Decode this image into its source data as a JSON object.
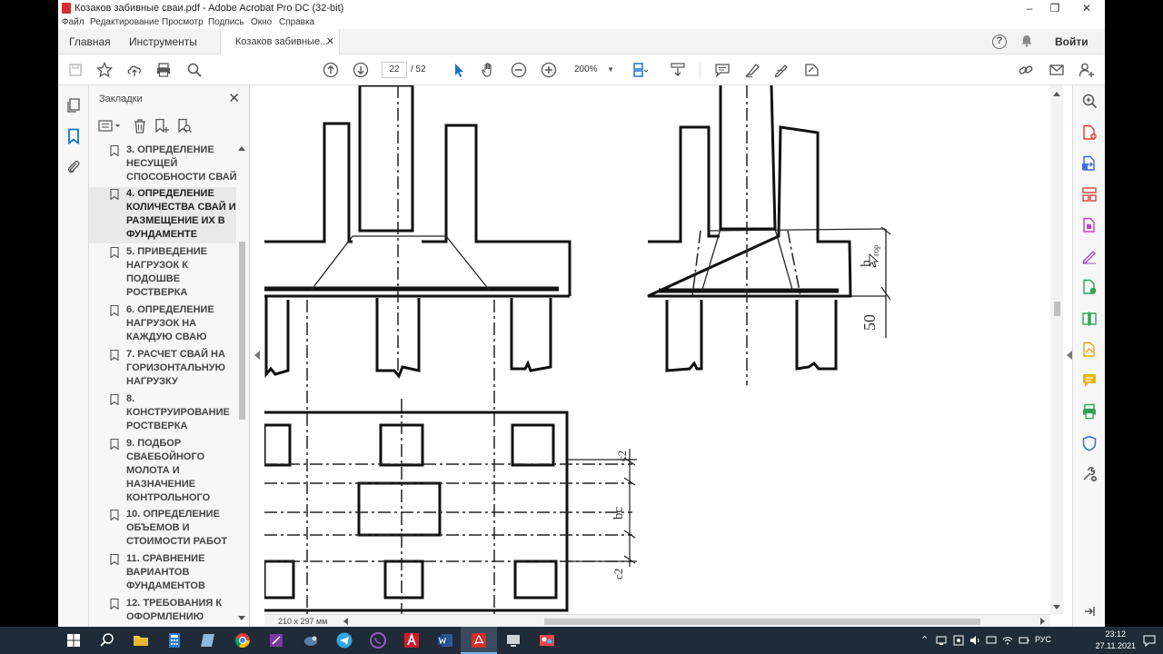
{
  "window": {
    "title": "Козаков забивные сваи.pdf - Adobe Acrobat Pro DC (32-bit)",
    "minimize": "–",
    "maximize": "❐",
    "close": "✕"
  },
  "menu": [
    "Файл",
    "Редактирование",
    "Просмотр",
    "Подпись",
    "Окно",
    "Справка"
  ],
  "tabs": {
    "home": "Главная",
    "tools": "Инструменты",
    "document": "Козаков забивные...",
    "document_close": "✕",
    "help": "?",
    "signin": "Войти"
  },
  "toolbar": {
    "page_current": "22",
    "page_total": "/ 52",
    "zoom": "200%",
    "icons": [
      "save-icon",
      "star-icon",
      "upload-icon",
      "print-icon",
      "search-icon",
      "page-up-icon",
      "page-down-icon",
      "select-cursor-icon",
      "hand-icon",
      "zoom-out-icon",
      "zoom-in-icon",
      "page-view-icon",
      "scroll-mode-icon",
      "comment-icon",
      "highlight-icon",
      "draw-icon",
      "sign-icon",
      "link-icon",
      "email-icon",
      "share-user-icon"
    ]
  },
  "bookmarks": {
    "header": "Закладки",
    "close": "✕",
    "items": [
      {
        "label": "3. ОПРЕДЕЛЕНИЕ НЕСУЩЕЙ СПОСОБНОСТИ СВАЙ",
        "selected": false
      },
      {
        "label": "4. ОПРЕДЕЛЕНИЕ КОЛИЧЕСТВА СВАЙ И РАЗМЕЩЕНИЕ ИХ В ФУНДАМЕНТЕ",
        "selected": true
      },
      {
        "label": "5. ПРИВЕДЕНИЕ НАГРУЗОК К ПОДОШВЕ РОСТВЕРКА",
        "selected": false
      },
      {
        "label": "6. ОПРЕДЕЛЕНИЕ НАГРУЗОК НА КАЖДУЮ СВАЮ",
        "selected": false
      },
      {
        "label": "7. РАСЧЕТ СВАЙ НА ГОРИЗОНТАЛЬНУЮ НАГРУЗКУ",
        "selected": false
      },
      {
        "label": "8. КОНСТРУИРОВАНИЕ РОСТВЕРКА",
        "selected": false
      },
      {
        "label": "9. ПОДБОР СВАЕБОЙНОГО МОЛОТА И НАЗНАЧЕНИЕ КОНТРОЛЬНОГО",
        "selected": false
      },
      {
        "label": "10. ОПРЕДЕЛЕНИЕ ОБЪЕМОВ И СТОИМОСТИ РАБОТ",
        "selected": false
      },
      {
        "label": "11. СРАВНЕНИЕ ВАРИАНТОВ ФУНДАМЕНТОВ",
        "selected": false
      },
      {
        "label": "12. ТРЕБОВАНИЯ К ОФОРМЛЕНИЮ",
        "selected": false
      }
    ]
  },
  "drawing": {
    "dim_50": "50",
    "dim_hop": "h",
    "dim_hop_sub": "гор",
    "dim_c2_top": "c2",
    "dim_bc": "bc",
    "dim_c2_bottom": "c2"
  },
  "statusbar": {
    "page_size": "210 x 297 мм"
  },
  "taskbar": {
    "lang": "РУС",
    "time": "23:12",
    "date": "27.11.2021"
  }
}
